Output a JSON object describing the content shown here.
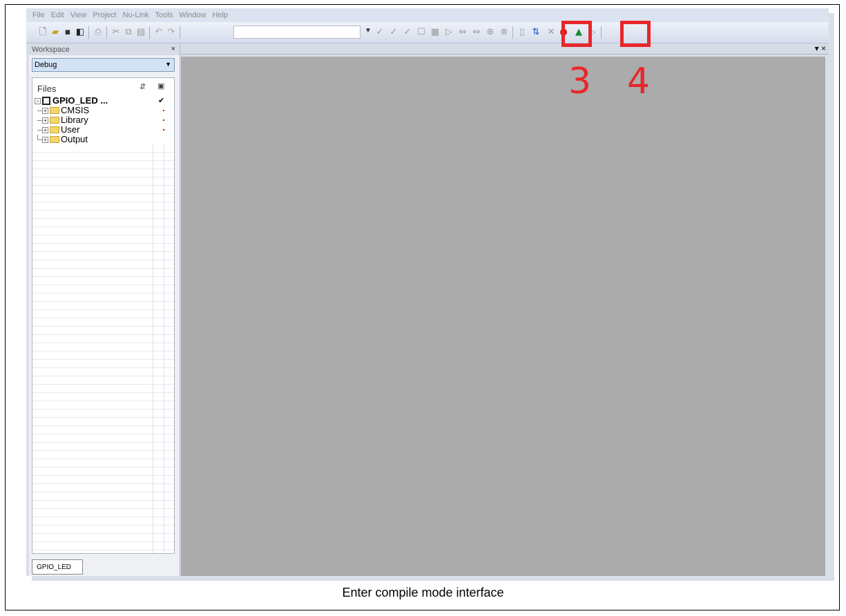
{
  "menu": [
    "File",
    "Edit",
    "View",
    "Project",
    "Nu-Link",
    "Tools",
    "Window",
    "Help"
  ],
  "toolbar": {
    "icons": [
      "new-file-icon",
      "open-folder-icon",
      "save-icon",
      "save-all-icon",
      "print-icon",
      "cut-icon",
      "copy-icon",
      "paste-icon",
      "undo-icon",
      "redo-icon",
      "bookmark-icons",
      "debug-icon",
      "stop-icon",
      "breakpoint-icon",
      "run-icon",
      "step-icon"
    ],
    "combo_value": ""
  },
  "annotations": {
    "label_3": "3",
    "label_4": "4",
    "color": "#e8262a"
  },
  "workspace": {
    "title": "Workspace",
    "close": "×",
    "config": "Debug",
    "files_header": "Files",
    "project": "GPIO_LED ...",
    "project_check": "✔",
    "folders": [
      "CMSIS",
      "Library",
      "User",
      "Output"
    ],
    "tab": "GPIO_LED"
  },
  "editor": {
    "controls": "▾ ×"
  },
  "caption": "Enter compile mode interface"
}
